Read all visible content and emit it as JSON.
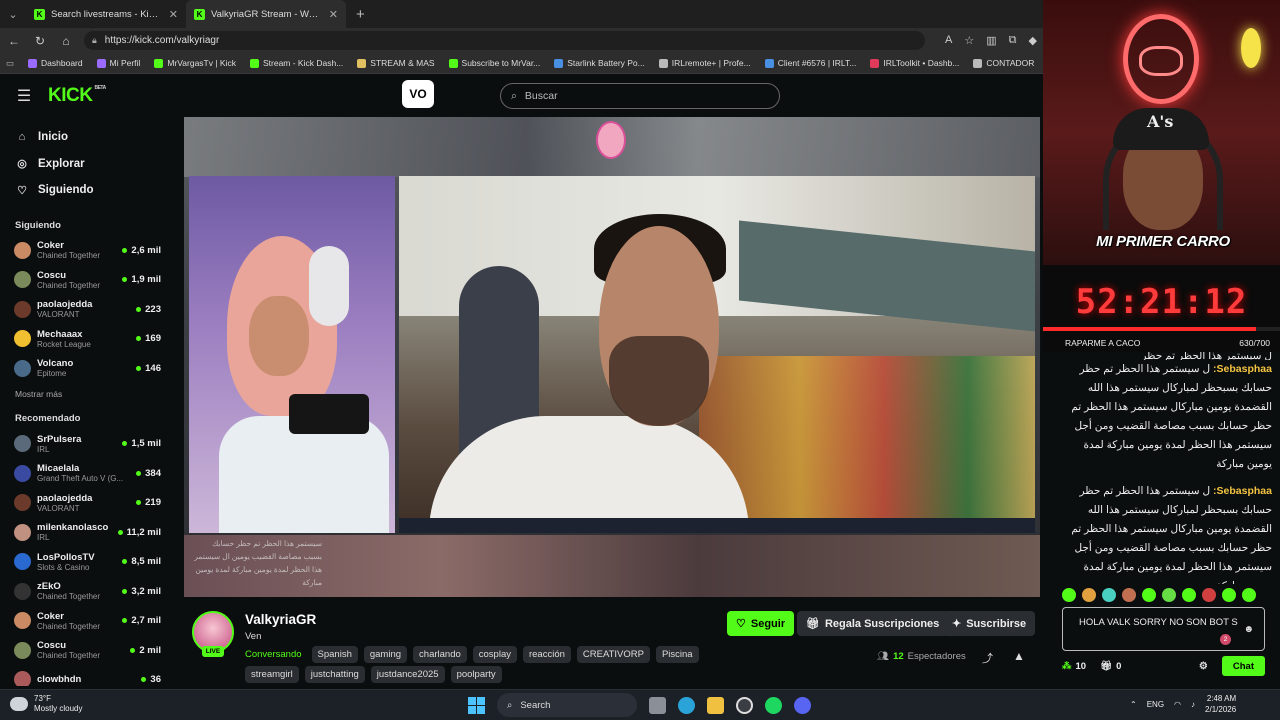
{
  "browser": {
    "tabs": [
      {
        "title": "Search livestreams - Kick Streamin",
        "close": "✕"
      },
      {
        "title": "ValkyriaGR Stream - Watch Li",
        "close": "✕"
      }
    ],
    "new_tab": "+",
    "url": "https://kick.com/valkyriagr",
    "bookmarks": [
      {
        "label": "Dashboard",
        "color": "#9b6bff"
      },
      {
        "label": "Mi Perfil",
        "color": "#9b6bff"
      },
      {
        "label": "MrVargasTv | Kick",
        "color": "#53fc18"
      },
      {
        "label": "Stream - Kick Dash...",
        "color": "#53fc18"
      },
      {
        "label": "STREAM & MAS",
        "color": "#e0c060"
      },
      {
        "label": "Subscribe to MrVar...",
        "color": "#53fc18"
      },
      {
        "label": "Starlink Battery Po...",
        "color": "#4a90e2"
      },
      {
        "label": "IRLremote+ | Profe...",
        "color": "#bbbbbb"
      },
      {
        "label": "Client #6576 | IRLT...",
        "color": "#4a90e2"
      },
      {
        "label": "IRLToolkit • Dashb...",
        "color": "#e23a5a"
      },
      {
        "label": "CONTADOR",
        "color": "#bbbbbb"
      }
    ]
  },
  "kick": {
    "logo": "KICK",
    "logo_sup": "BETA",
    "vo_label": "VO",
    "search_placeholder": "Buscar",
    "nav": [
      {
        "label": "Inicio",
        "icon": "⌂"
      },
      {
        "label": "Explorar",
        "icon": "◎"
      },
      {
        "label": "Siguiendo",
        "icon": "♡"
      }
    ],
    "following_header": "Siguiendo",
    "following": [
      {
        "name": "Coker",
        "category": "Chained Together",
        "viewers": "2,6 mil",
        "color": "#c98a64"
      },
      {
        "name": "Coscu",
        "category": "Chained Together",
        "viewers": "1,9 mil",
        "color": "#7a8a5a"
      },
      {
        "name": "paolaojedda",
        "category": "VALORANT",
        "viewers": "223",
        "color": "#6b3a2a"
      },
      {
        "name": "Mechaaax",
        "category": "Rocket League",
        "viewers": "169",
        "color": "#f0c030"
      },
      {
        "name": "Volcano",
        "category": "Epitome",
        "viewers": "146",
        "color": "#4a6a8a"
      }
    ],
    "more_label": "Mostrar más",
    "recommended_header": "Recomendado",
    "recommended": [
      {
        "name": "SrPulsera",
        "category": "IRL",
        "viewers": "1,5 mil",
        "color": "#5a6a7a"
      },
      {
        "name": "Micaelala",
        "category": "Grand Theft Auto V (G...",
        "viewers": "384",
        "color": "#3a4aa0"
      },
      {
        "name": "paolaojedda",
        "category": "VALORANT",
        "viewers": "219",
        "color": "#6b3a2a"
      },
      {
        "name": "milenkanolasco",
        "category": "IRL",
        "viewers": "11,2 mil",
        "color": "#c09080"
      },
      {
        "name": "LosPollosTV",
        "category": "Slots & Casino",
        "viewers": "8,5 mil",
        "color": "#2a6ad0"
      },
      {
        "name": "zEkO",
        "category": "Chained Together",
        "viewers": "3,2 mil",
        "color": "#333333"
      },
      {
        "name": "Coker",
        "category": "Chained Together",
        "viewers": "2,7 mil",
        "color": "#c98a64"
      },
      {
        "name": "Coscu",
        "category": "Chained Together",
        "viewers": "2 mil",
        "color": "#7a8a5a"
      },
      {
        "name": "clowbhdn",
        "category": "",
        "viewers": "36",
        "color": "#aa5a5a"
      }
    ]
  },
  "player": {
    "overlay_text": "سيستمر هذا الحظر تم حظر حسابك بسبب مصاصة القضيب يومين ال سيستمر هذا الحظر لمدة يومين مباركة لمدة يومين مباركة"
  },
  "stream": {
    "name": "ValkyriaGR",
    "title": "Ven",
    "live": "LIVE",
    "category": "Conversando",
    "tags_row1": [
      "Spanish",
      "gaming",
      "charlando",
      "cosplay",
      "reacción",
      "CREATIVORP",
      "Piscina"
    ],
    "tags_row2": [
      "streamgirl",
      "justchatting",
      "justdance2025",
      "poolparty"
    ],
    "follow_label": "Seguir",
    "gift_label": "Regala Suscripciones",
    "subscribe_label": "Suscribirse",
    "viewers_count": "12",
    "viewers_label": "Espectadores"
  },
  "overlay": {
    "banner": "MI PRIMER CARRO",
    "timer": "52:21:12",
    "goal_label": "RAPARME A CACO",
    "goal_count": "630/700",
    "goal_progress": 0.9
  },
  "chat": {
    "partial_message": "ل سيستمر هذا الحظر تم حظر",
    "messages": [
      {
        "user": "Sebasphaa:",
        "text": "ل سيستمر هذا الحظر تم حظر حسابك بسبحظر لمباركال سيستمر هذا الله القضمدة يومين مباركال سيستمر هذا الحظر تم حظر حسابك بسبب مصاصة القضيب ومن أجل سيستمر هذا الحظر لمدة يومين مباركة لمدة يومين مباركة"
      },
      {
        "user": "Sebasphaa:",
        "text": "ل سيستمر هذا الحظر تم حظر حسابك بسبحظر لمباركال سيستمر هذا الله القضمدة يومين مباركال سيستمر هذا الحظر تم حظر حسابك بسبب مصاصة القضيب ومن أجل سيستمر هذا الحظر لمدة يومين مباركة لمدة يومين مباركة"
      }
    ],
    "emote_colors": [
      "#53fc18",
      "#e0a040",
      "#4ad0c0",
      "#c07050",
      "#53fc18",
      "#66dd44",
      "#53fc18",
      "#d04040",
      "#53fc18",
      "#53fc18"
    ],
    "input_value": "HOLA VALK SORRY NO SON BOT S",
    "input_badge": "2",
    "points": "10",
    "gifts": "0",
    "chat_button": "Chat"
  },
  "taskbar": {
    "temp": "73°F",
    "weather": "Mostly cloudy",
    "search_label": "Search",
    "lang": "ENG",
    "time": "2:48 AM",
    "date": "2/1/2026"
  }
}
